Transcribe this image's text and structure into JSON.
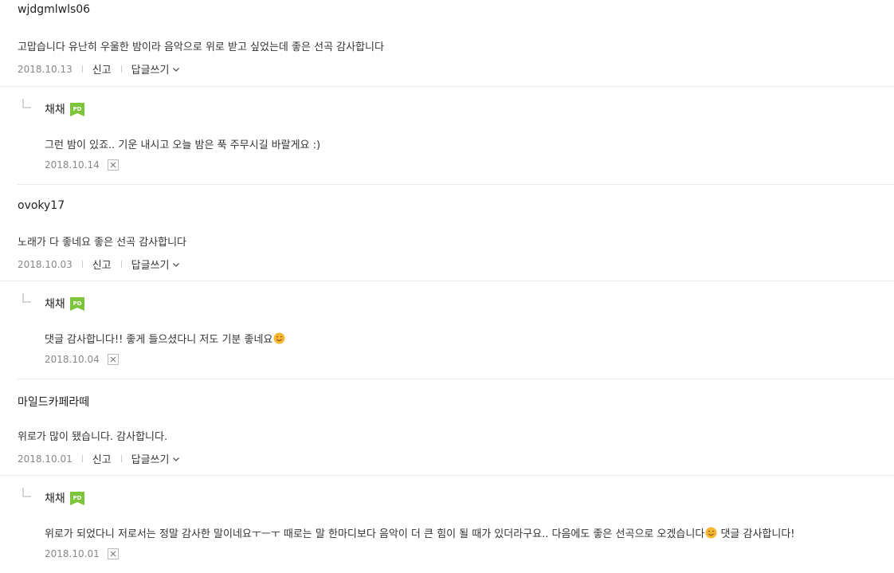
{
  "comments": [
    {
      "author": "wjdgmlwls06",
      "text": "고맙습니다 유난히 우울한 밤이라 음악으로 위로 받고 싶었는데 좋은 선곡 감사합니다",
      "date": "2018.10.13",
      "report_label": "신고",
      "reply_label": "답글쓰기",
      "reply": {
        "author": "채채",
        "badge": "PD",
        "text": "그런 밤이 있죠.. 기운 내시고 오늘 밤은 푹 주무시길 바랄게요 :)",
        "date": "2018.10.14"
      }
    },
    {
      "author": "ovoky17",
      "text": "노래가 다 좋네요 좋은 선곡 감사합니다",
      "date": "2018.10.03",
      "report_label": "신고",
      "reply_label": "답글쓰기",
      "reply": {
        "author": "채채",
        "badge": "PD",
        "text": "댓글 감사합니다!! 좋게 들으셨다니 저도 기분 좋네요",
        "date": "2018.10.04"
      }
    },
    {
      "author": "마일드카페라떼",
      "text": "위로가 많이 됐습니다. 감사합니다.",
      "date": "2018.10.01",
      "report_label": "신고",
      "reply_label": "답글쓰기",
      "reply": {
        "author": "채채",
        "badge": "PD",
        "text_part1": "위로가 되었다니 저로서는 정말 감사한 말이네요ㅜㅡㅜ 때로는 말 한마디보다 음악이 더 큰 힘이 될 때가 있더라구요.. 다음에도 좋은 선곡으로 오겠습니다",
        "text_part2": " 댓글 감사합니다!",
        "date": "2018.10.01"
      }
    }
  ],
  "colors": {
    "badge_green": "#7cc43a",
    "emoji_yellow": "#f7b733"
  }
}
